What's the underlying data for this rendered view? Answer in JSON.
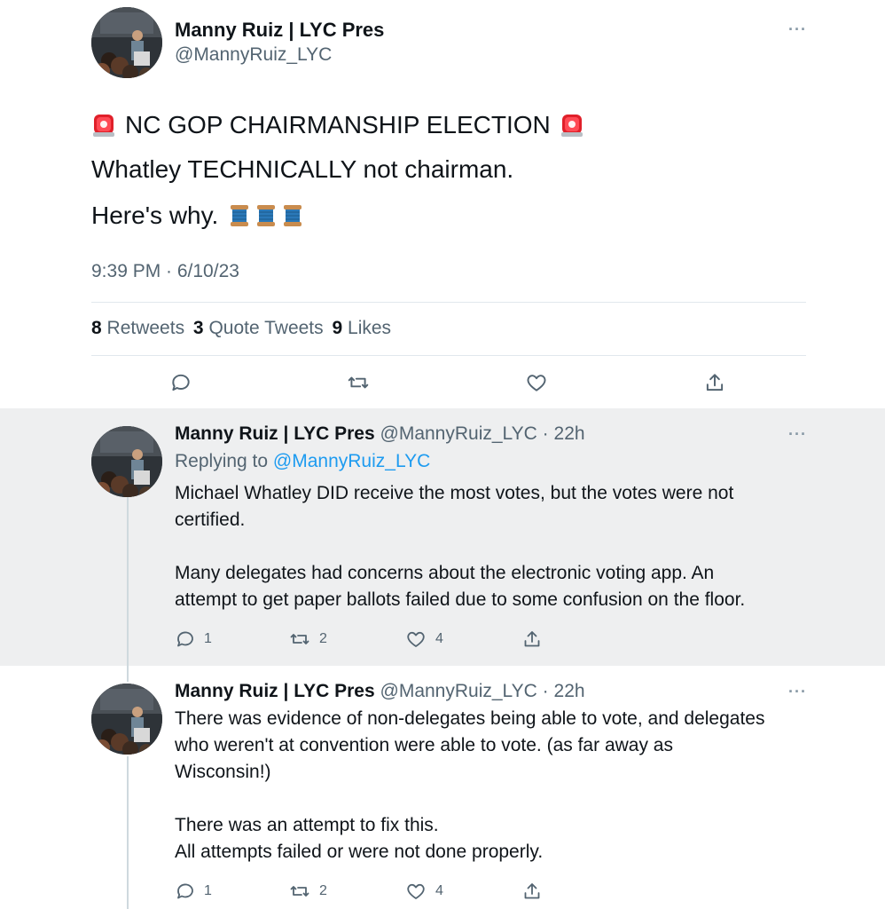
{
  "main_tweet": {
    "author_name": "Manny Ruiz | LYC Pres",
    "author_handle": "@MannyRuiz_LYC",
    "line1": "NC GOP CHAIRMANSHIP ELECTION",
    "line2": "Whatley TECHNICALLY not chairman.",
    "line3": "Here's why.",
    "timestamp": "9:39 PM · 6/10/23",
    "stats": {
      "retweets_count": "8",
      "retweets_label": "Retweets",
      "quotes_count": "3",
      "quotes_label": "Quote Tweets",
      "likes_count": "9",
      "likes_label": "Likes"
    },
    "more": "···"
  },
  "replies": [
    {
      "author_name": "Manny Ruiz | LYC Pres",
      "author_handle": "@MannyRuiz_LYC · 22h",
      "replying_prefix": "Replying to ",
      "replying_to": "@MannyRuiz_LYC",
      "text": "Michael Whatley DID receive the most votes, but the votes were not\ncertified.\n\nMany delegates had concerns about the electronic voting app. An\nattempt to get paper ballots failed due to some confusion on the floor.",
      "reply_count": "1",
      "retweet_count": "2",
      "like_count": "4",
      "more": "···"
    },
    {
      "author_name": "Manny Ruiz | LYC Pres",
      "author_handle": "@MannyRuiz_LYC · 22h",
      "text": "There was evidence of non-delegates being able to vote, and delegates\nwho weren't at convention were able to vote. (as far away as\nWisconsin!)\n\nThere was an attempt to fix this.\nAll attempts failed or were not done properly.",
      "reply_count": "1",
      "retweet_count": "2",
      "like_count": "4",
      "more": "···"
    }
  ],
  "icons": {
    "siren": "police-car-light-icon",
    "thread": "spool-of-thread-icon",
    "reply": "reply-icon",
    "retweet": "retweet-icon",
    "like": "heart-icon",
    "share": "share-icon"
  },
  "colors": {
    "text": "#0f1419",
    "muted": "#536471",
    "link": "#1d9bf0",
    "highlight_bg": "#eeeff0",
    "siren_red": "#e0202a"
  }
}
